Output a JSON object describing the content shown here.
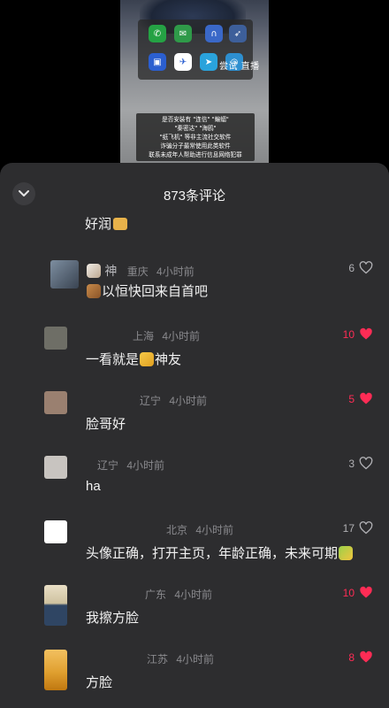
{
  "video": {
    "overlay_text": "尝试  直播",
    "warning_lines": [
      "是否安装有 \"连信\" \"蝙蝠\"",
      "\"秦密达\" \"海鸥\"",
      "\"纸飞机\" 等非主流社交软件",
      "诈骗分子最常使用此类软件",
      "联系未成年人帮助进行信息网络犯罪"
    ],
    "apps": [
      {
        "icon": "whatsapp-icon",
        "color": "#25a244"
      },
      {
        "icon": "chat-bubble-icon",
        "color": "#2f9a49"
      },
      {
        "icon": "arch-app-icon",
        "color": "#3a68c8"
      },
      {
        "icon": "bird-app-icon",
        "color": "#3d5f9a"
      },
      {
        "icon": "square-app-icon",
        "color": "#2b5fd0"
      },
      {
        "icon": "bat-app-icon",
        "color": "#ffffff"
      },
      {
        "icon": "telegram-icon",
        "color": "#2aa3dc"
      },
      {
        "icon": "seagull-app-icon",
        "color": "#2d8fd0"
      }
    ]
  },
  "panel": {
    "title": "873条评论",
    "partial_comment": "好润"
  },
  "comments": [
    {
      "name": "神",
      "location": "重庆",
      "time": "4小时前",
      "text": "以恒快回来自首吧",
      "likes": "6",
      "liked": false,
      "avatar_color": "#5a6a7a"
    },
    {
      "name": "",
      "location": "上海",
      "time": "4小时前",
      "text": "一看就是",
      "text_suffix": "神友",
      "likes": "10",
      "liked": true,
      "avatar_color": "#6e6e66"
    },
    {
      "name": "",
      "location": "辽宁",
      "time": "4小时前",
      "text": "脸哥好",
      "likes": "5",
      "liked": true,
      "avatar_color": "#9a8070"
    },
    {
      "name": "",
      "location": "辽宁",
      "time": "4小时前",
      "text": "ha",
      "likes": "3",
      "liked": false,
      "avatar_color": "#c8c4c0"
    },
    {
      "name": "",
      "location": "北京",
      "time": "4小时前",
      "text": "头像正确，打开主页，年龄正确，未来可期",
      "likes": "17",
      "liked": false,
      "avatar_color": "#ffffff"
    },
    {
      "name": "",
      "location": "广东",
      "time": "4小时前",
      "text": "我擦方脸",
      "likes": "10",
      "liked": true,
      "avatar_color": "#2f4563"
    },
    {
      "name": "",
      "location": "江苏",
      "time": "4小时前",
      "text": "方脸",
      "likes": "8",
      "liked": true,
      "avatar_color": "#e0a030"
    }
  ],
  "colors": {
    "accent_red": "#fe2c55",
    "panel_bg": "#2d2d2f",
    "meta_gray": "#8a8a8e"
  }
}
